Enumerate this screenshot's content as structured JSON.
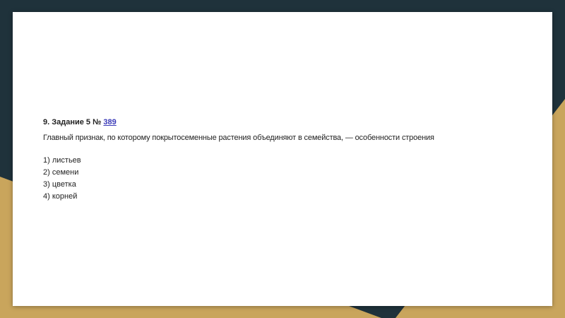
{
  "task": {
    "title_prefix": "9. Задание 5 № ",
    "number_link": "389",
    "question": "Главный признак, по которому покрытосеменные растения объединяют в семейства, — особенности строения"
  },
  "options": [
    "1) листьев",
    "2) семени",
    "3) цветка",
    "4) корней"
  ],
  "colors": {
    "background_dark": "#1f323b",
    "background_gold": "#c9a55c",
    "slide": "#ffffff",
    "link": "#3b3bb8"
  }
}
